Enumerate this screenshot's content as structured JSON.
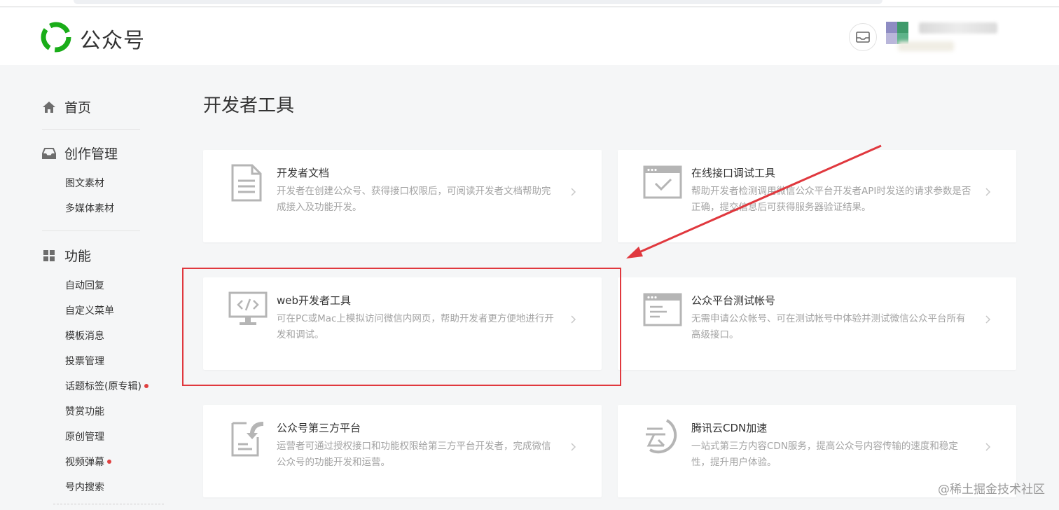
{
  "header": {
    "brand": "公众号",
    "logo_icon": "wechat-official-accounts-logo",
    "mail_icon": "mail-icon"
  },
  "sidebar": {
    "sections": [
      {
        "label": "首页",
        "icon": "home-icon",
        "items": []
      },
      {
        "label": "创作管理",
        "icon": "inbox-icon",
        "items": [
          {
            "label": "图文素材",
            "dot": false
          },
          {
            "label": "多媒体素材",
            "dot": false
          }
        ]
      },
      {
        "label": "功能",
        "icon": "grid-icon",
        "items": [
          {
            "label": "自动回复",
            "dot": false
          },
          {
            "label": "自定义菜单",
            "dot": false
          },
          {
            "label": "模板消息",
            "dot": false
          },
          {
            "label": "投票管理",
            "dot": false
          },
          {
            "label": "话题标签(原专辑)",
            "dot": true
          },
          {
            "label": "赞赏功能",
            "dot": false
          },
          {
            "label": "原创管理",
            "dot": false
          },
          {
            "label": "视频弹幕",
            "dot": true
          },
          {
            "label": "号内搜索",
            "dot": false
          }
        ]
      }
    ]
  },
  "main": {
    "title": "开发者工具",
    "cards": [
      {
        "title": "开发者文档",
        "desc": "开发者在创建公众号、获得接口权限后，可阅读开发者文档帮助完成接入及功能开发。",
        "icon": "document-icon"
      },
      {
        "title": "在线接口调试工具",
        "desc": "帮助开发者检测调用微信公众平台开发者API时发送的请求参数是否正确，提交信息后可获得服务器验证结果。",
        "icon": "browser-check-icon"
      },
      {
        "title": "web开发者工具",
        "desc": "可在PC或Mac上模拟访问微信内网页，帮助开发者更方便地进行开发和调试。",
        "icon": "monitor-code-icon"
      },
      {
        "title": "公众平台测试帐号",
        "desc": "无需申请公众帐号、可在测试帐号中体验并测试微信公众平台所有高级接口。",
        "icon": "browser-window-icon"
      },
      {
        "title": "公众号第三方平台",
        "desc": "运营者可通过授权接口和功能权限给第三方平台开发者，完成微信公众号的功能开发和运营。",
        "icon": "document-arrow-icon"
      },
      {
        "title": "腾讯云CDN加速",
        "desc": "一站式第三方内容CDN服务，提高公众号内容传输的速度和稳定性，提升用户体验。",
        "icon": "tencent-cloud-icon"
      }
    ]
  },
  "watermark": "@稀土掘金技术社区",
  "colors": {
    "brand_green": "#1aad19",
    "annotation_red": "#e0383e",
    "background": "#f5f6f7"
  }
}
